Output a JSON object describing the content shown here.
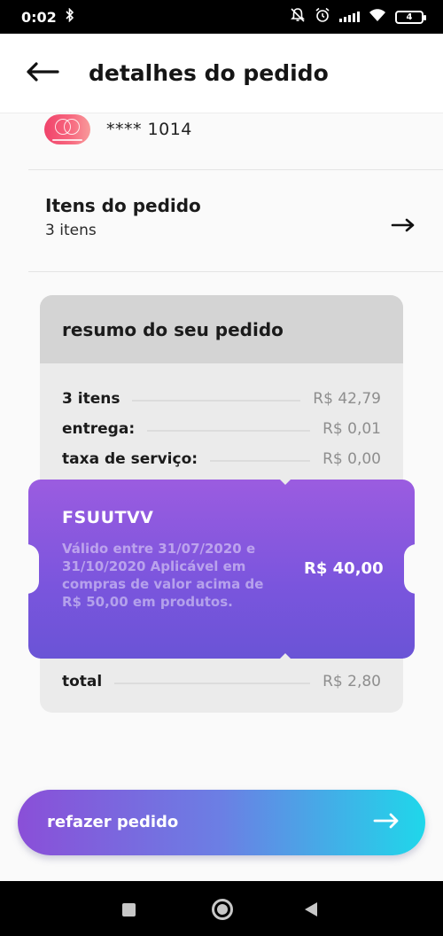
{
  "status_bar": {
    "time": "0:02",
    "battery": "4",
    "icons": [
      "bluetooth-icon",
      "notifications-off-icon",
      "alarm-icon",
      "signal-icon",
      "wifi-icon",
      "battery-icon"
    ]
  },
  "header": {
    "back_icon": "arrow-left-icon",
    "title": "detalhes do pedido"
  },
  "payment": {
    "card_brand_icon": "mastercard-icon",
    "card_number": "**** 1014"
  },
  "items": {
    "title": "Itens do pedido",
    "count": "3 itens",
    "arrow_icon": "arrow-right-icon"
  },
  "summary": {
    "title": "resumo do seu pedido",
    "lines": [
      {
        "label": "3 itens",
        "value": "R$ 42,79"
      },
      {
        "label": "entrega:",
        "value": "R$ 0,01"
      },
      {
        "label": "taxa de serviço:",
        "value": "R$ 0,00"
      }
    ],
    "coupon": {
      "code": "FSUUTVV",
      "description": "Válido entre 31/07/2020 e 31/10/2020 Aplicável em compras de valor acima de R$ 50,00 em produtos.",
      "value": "R$ 40,00"
    },
    "total": {
      "label": "total",
      "value": "R$ 2,80"
    }
  },
  "cta": {
    "label": "refazer pedido",
    "arrow_icon": "arrow-right-icon"
  },
  "colors": {
    "coupon": "#7a55dd",
    "cta_start": "#8a4fd8",
    "cta_end": "#1fd7ea",
    "card_logo": "#f0436b"
  }
}
